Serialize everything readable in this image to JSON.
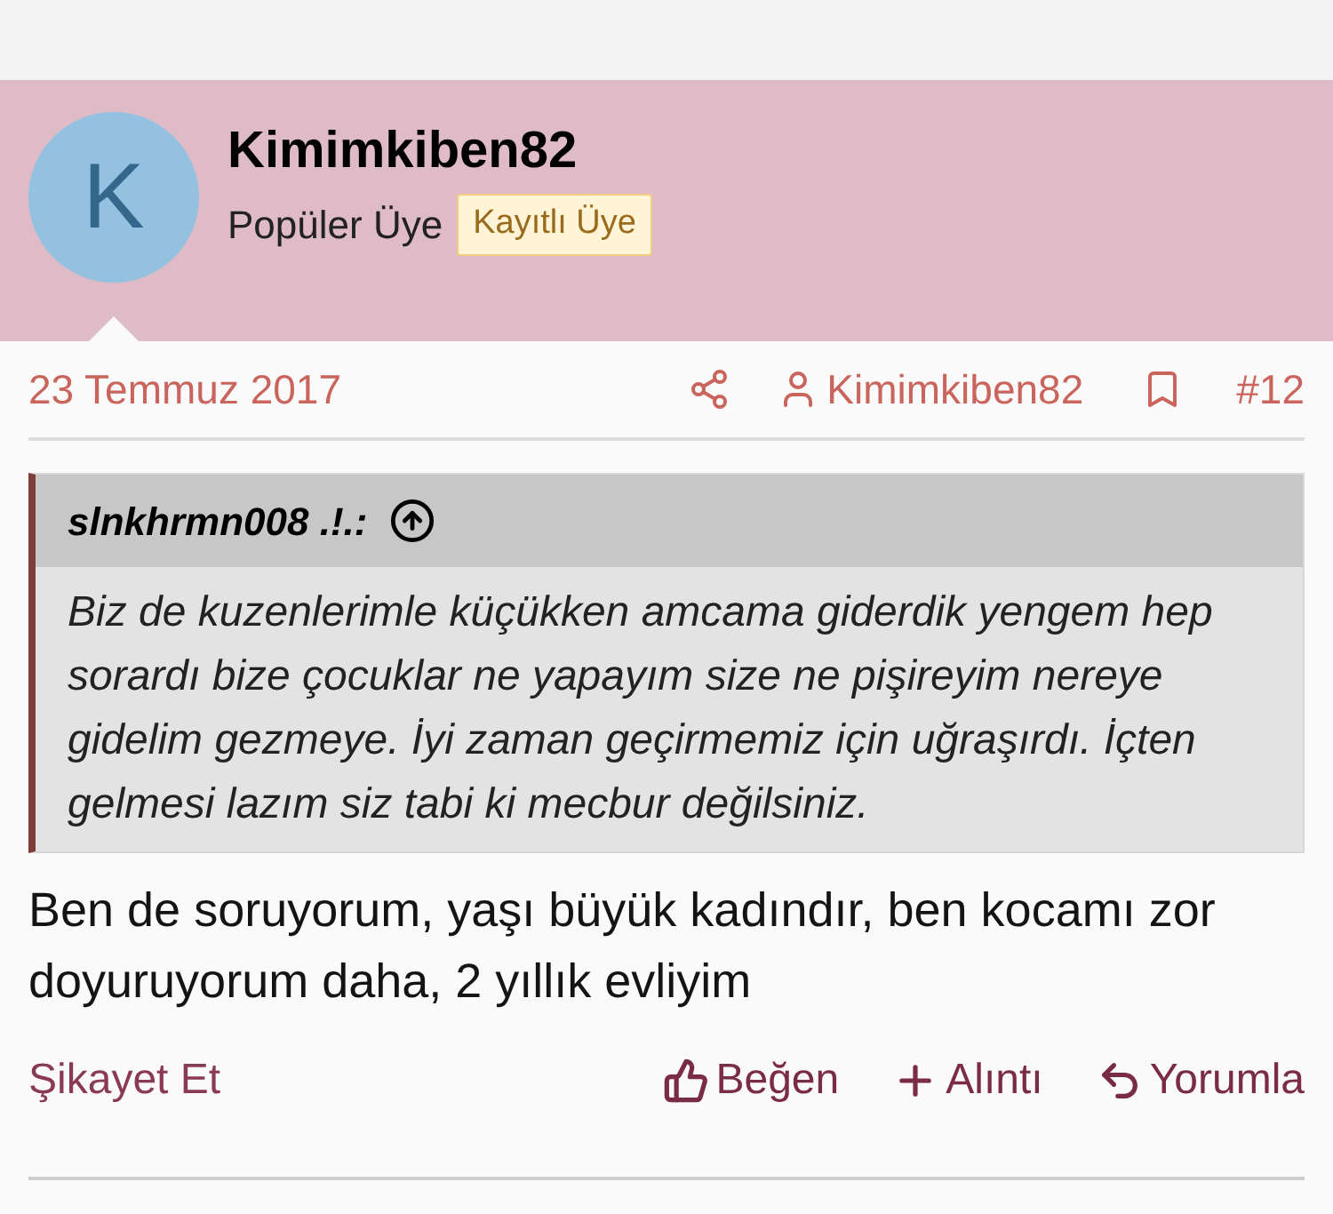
{
  "author": {
    "avatar_letter": "K",
    "name": "Kimimkiben82",
    "title": "Popüler Üye",
    "badge": "Kayıtlı Üye"
  },
  "meta": {
    "date": "23 Temmuz 2017",
    "author_link": "Kimimkiben82",
    "post_number": "#12"
  },
  "quote": {
    "author": "slnkhrmn008 .!.:",
    "text": "Biz de kuzenlerimle küçükken amcama giderdik yengem hep sorardı bize çocuklar ne yapayım size ne pişireyim nereye gidelim gezmeye. İyi zaman geçirmemiz için uğraşırdı. İçten gelmesi lazım siz tabi ki mecbur değilsiniz."
  },
  "body": "Ben de soruyorum, yaşı büyük kadındır, ben kocamı zor doyuruyorum daha, 2 yıllık evliyim",
  "actions": {
    "report": "Şikayet Et",
    "buttons": [
      {
        "kind": "like",
        "label": "Beğen"
      },
      {
        "kind": "quote",
        "label": "Alıntı"
      },
      {
        "kind": "reply",
        "label": "Yorumla"
      }
    ]
  }
}
